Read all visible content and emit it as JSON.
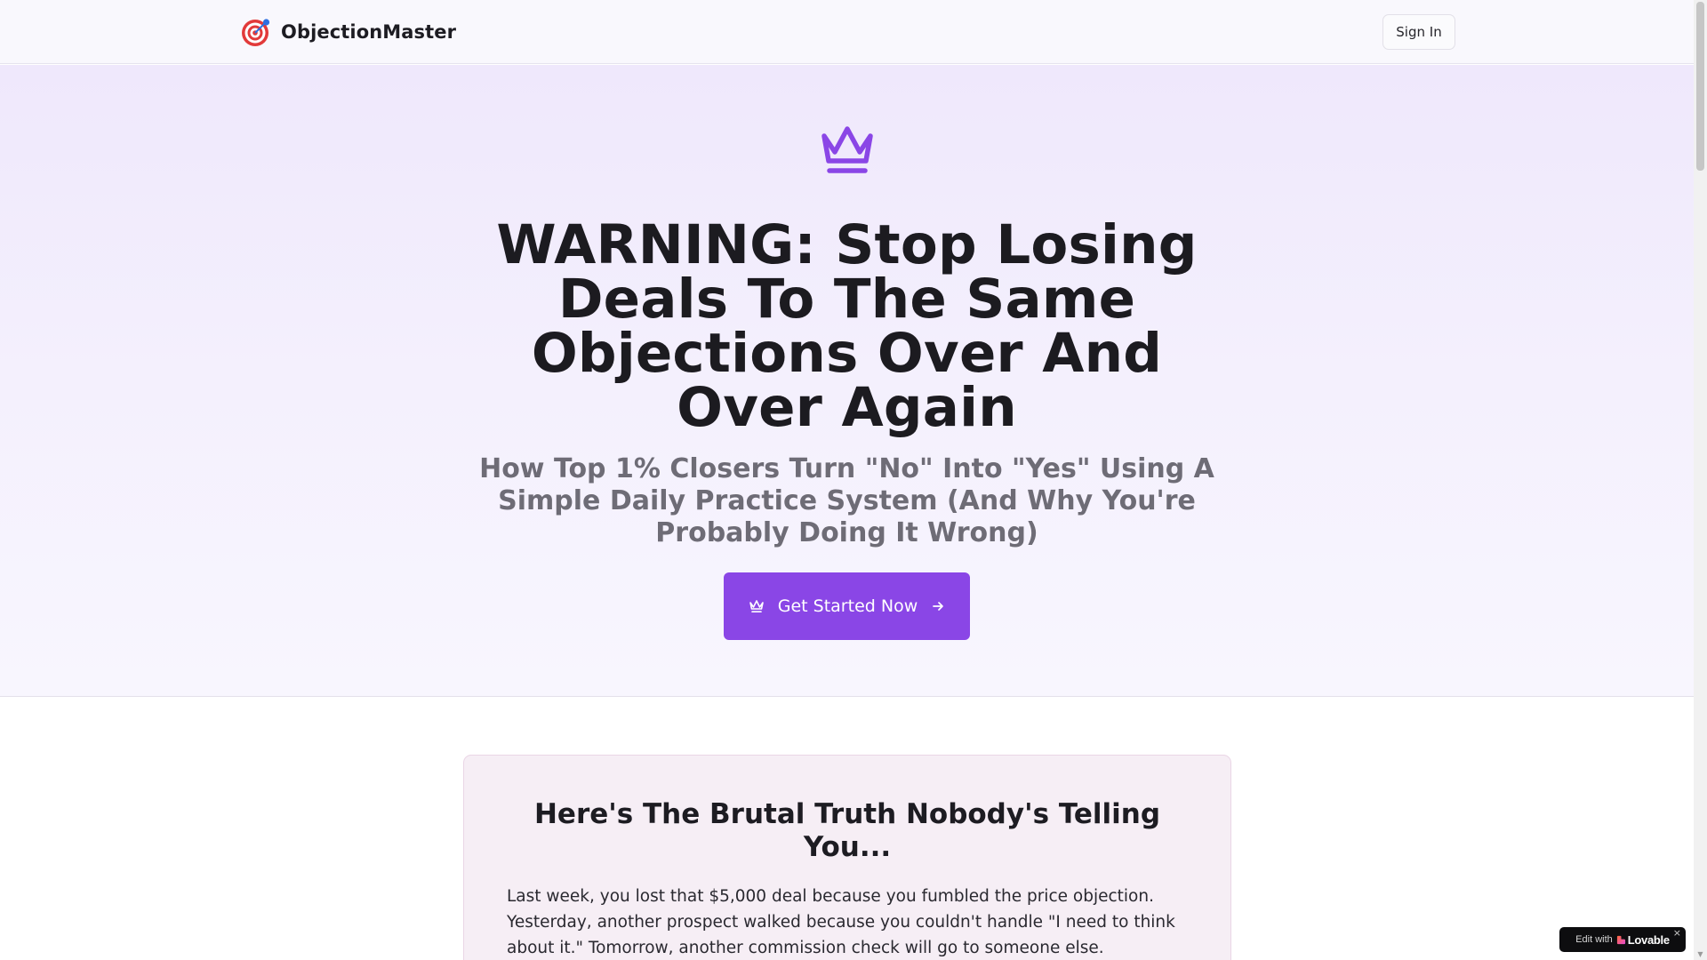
{
  "header": {
    "brand_name": "ObjectionMaster",
    "sign_in_label": "Sign In"
  },
  "hero": {
    "title": "WARNING: Stop Losing Deals To The Same Objections Over And Over Again",
    "subtitle": "How Top 1% Closers Turn \"No\" Into \"Yes\" Using A Simple Daily Practice System (And Why You're Probably Doing It Wrong)",
    "cta_label": "Get Started Now"
  },
  "truth": {
    "title": "Here's The Brutal Truth Nobody's Telling You...",
    "body": "Last week, you lost that $5,000 deal because you fumbled the price objection. Yesterday, another prospect walked because you couldn't handle \"I need to think about it.\" Tomorrow, another commission check will go to someone else."
  },
  "badge": {
    "prefix": "Edit with",
    "brand": "Lovable",
    "close": "×"
  },
  "colors": {
    "accent": "#8a46e6",
    "logo_red": "#e23a3a",
    "logo_blue": "#2f6fe0"
  },
  "icons": [
    "target-logo-icon",
    "crown-icon",
    "arrow-right-icon",
    "lovable-heart-icon",
    "close-icon"
  ]
}
